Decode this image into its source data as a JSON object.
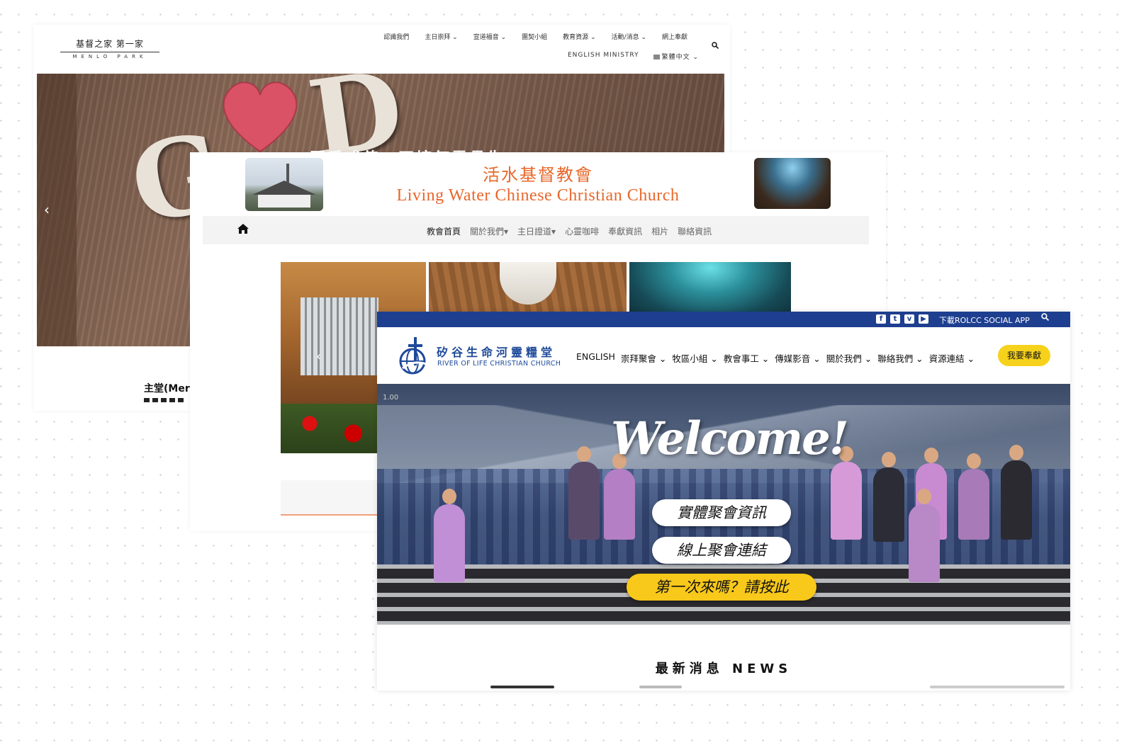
{
  "menlo": {
    "logo_cn": "基督之家 第一家",
    "logo_en": "MENLO PARK",
    "nav_row1": [
      "認識我們",
      "主日崇拜 ⌄",
      "宣道福音 ⌄",
      "團契小組",
      "教育資源 ⌄",
      "活動/消息 ⌄",
      "網上奉獻"
    ],
    "nav_row2": [
      "ENGLISH MINISTRY",
      "繁體中文 ⌄"
    ],
    "lang_icon": "flag-icon",
    "search_icon": "search-icon",
    "hero_overlay": "同手成值，正塘何需贯生",
    "prev_arrow": "‹",
    "caption": "主堂(Mer"
  },
  "livingwater": {
    "title_cn": "活水基督教會",
    "title_en": "Living Water Chinese Christian Church",
    "home_icon": "home-icon",
    "menu": [
      "教會首頁",
      "關於我們▾",
      "主日證道▾",
      "心靈咖啡",
      "奉獻資訊",
      "相片",
      "聯絡資訊"
    ],
    "prev_arrow": "‹"
  },
  "riveroflife": {
    "social": [
      "f",
      "t",
      "v",
      "▶"
    ],
    "app_link": "下載ROLCC SOCIAL APP",
    "search_icon": "search-icon",
    "logo_cn": "矽谷生命河靈糧堂",
    "logo_en": "RIVER OF LIFE CHRISTIAN CHURCH",
    "nav": [
      "ENGLISH",
      "崇拜聚會 ⌄",
      "牧區小組 ⌄",
      "教會事工 ⌄",
      "傳媒影音 ⌄",
      "關於我們 ⌄",
      "聯絡我們 ⌄",
      "資源連結 ⌄"
    ],
    "give_button": "我要奉獻",
    "slide_counter": "1.00",
    "welcome": "Welcome!",
    "btn_inperson": "實體聚會資訊",
    "btn_online": "線上聚會連結",
    "btn_first": "第一次來嗎？請按此",
    "news_heading": "最新消息 NEWS",
    "colors": {
      "brand_blue": "#1e3f8f",
      "button_yellow": "#f6d21c"
    }
  }
}
